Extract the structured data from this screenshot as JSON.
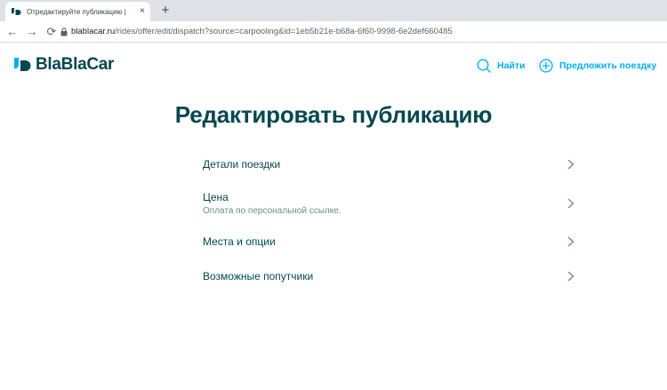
{
  "browser": {
    "tab_title": "Отредактируйте публикацию | ",
    "tab_close": "×",
    "new_tab": "+",
    "url_domain": "blablacar.ru",
    "url_path": "/rides/offer/edit/dispatch?source=carpooling&id=1eb5b21e-b68a-6f60-9998-6e2def660485",
    "back": "←",
    "forward": "→",
    "reload": "⟳"
  },
  "header": {
    "logo_text": "BlaBlaCar",
    "search_label": "Найти",
    "offer_label": "Предложить поездку"
  },
  "main": {
    "title": "Редактировать публикацию",
    "items": [
      {
        "label": "Детали поездки",
        "sub": ""
      },
      {
        "label": "Цена",
        "sub": "Оплата по персональной ссылке."
      },
      {
        "label": "Места и опции",
        "sub": ""
      },
      {
        "label": "Возможные попутчики",
        "sub": ""
      }
    ]
  },
  "colors": {
    "brand_dark": "#054752",
    "accent": "#00aff5",
    "subtext": "#708c91"
  },
  "icons": {
    "search": "search-icon",
    "offer": "plus-circle-icon",
    "chevron": "chevron-right-icon"
  }
}
